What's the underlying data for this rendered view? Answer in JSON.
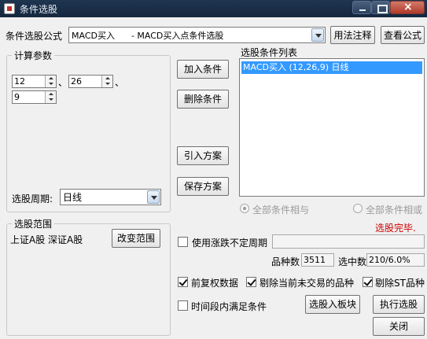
{
  "window": {
    "title": "条件选股"
  },
  "formula": {
    "label": "条件选股公式",
    "selected": "MACD买入      - MACD买入点条件选股",
    "usage_button": "用法注释",
    "view_button": "查看公式"
  },
  "params": {
    "group_title": "计算参数",
    "p1": "12",
    "p2": "26",
    "p3": "9",
    "sep": "、"
  },
  "period": {
    "label": "选股周期:",
    "selected": "日线"
  },
  "buttons": {
    "add": "加入条件",
    "delete": "删除条件",
    "import": "引入方案",
    "save": "保存方案",
    "change_range": "改变范围",
    "to_block": "选股入板块",
    "execute": "执行选股",
    "close": "关闭"
  },
  "conditions": {
    "title": "选股条件列表",
    "items": [
      "MACD买入 (12,26,9) 日线"
    ]
  },
  "logic": {
    "all_and": "全部条件相与",
    "all_or": "全部条件相或"
  },
  "status": "选股完毕.",
  "range": {
    "title": "选股范围",
    "value": "上证A股 深证A股"
  },
  "options": {
    "variable_period": "使用涨跌不定周期",
    "pre_adjust": "前复权数据",
    "exclude_untraded": "剔除当前未交易的品种",
    "exclude_st": "剔除ST品种",
    "time_range": "时间段内满足条件"
  },
  "stats": {
    "count_label": "品种数",
    "count_value": "3511",
    "selected_label": "选中数",
    "selected_value": "210/6.0%"
  }
}
